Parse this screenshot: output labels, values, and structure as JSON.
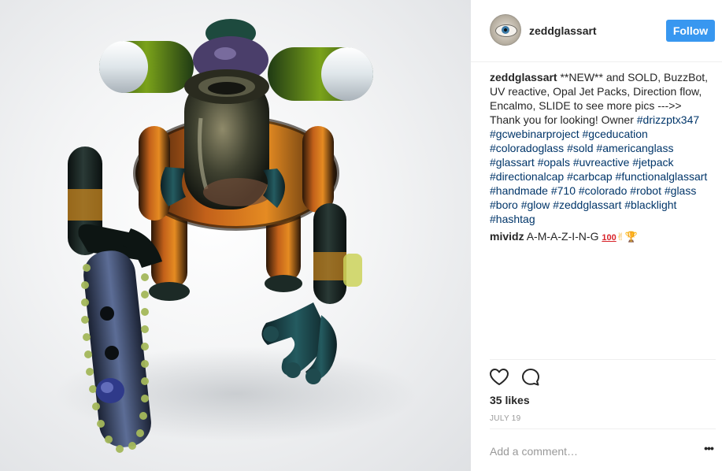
{
  "post": {
    "username": "zeddglassart",
    "follow_label": "Follow",
    "likes_text": "35 likes",
    "date_text": "JULY 19",
    "comment_placeholder": "Add a comment…",
    "more_label": "•••"
  },
  "caption": {
    "user": "zeddglassart",
    "text_lines": [
      "**NEW** and SOLD,",
      "BuzzBot, UV reactive, Opal Jet Packs,",
      "Direction flow, Encalmo, SLIDE to see more",
      "pics --->>",
      "Thank you for looking! Owner "
    ],
    "hashtags": [
      "#drizzptx347",
      "#gcwebinarproject",
      "#gceducation",
      "#coloradoglass",
      "#sold",
      "#americanglass",
      "#glassart",
      "#opals",
      "#uvreactive",
      "#jetpack",
      "#directionalcap",
      "#carbcap",
      "#functionalglassart",
      "#handmade",
      "#710",
      "#colorado",
      "#robot",
      "#glass",
      "#boro",
      "#glow",
      "#zeddglassart",
      "#blacklight",
      "#hashtag"
    ]
  },
  "comment2": {
    "user": "mividz",
    "text": "A-M-A-Z-I-N-G",
    "emoji_100": "100",
    "emoji_peace": "✌",
    "emoji_trophy": "🏆"
  },
  "icons": {
    "like": "heart-icon",
    "comment": "comment-bubble-icon",
    "more": "more-options-icon"
  },
  "colors": {
    "follow_button": "#3897f0",
    "hashtag": "#003569",
    "meta_text": "#999999",
    "divider": "#efefef"
  }
}
